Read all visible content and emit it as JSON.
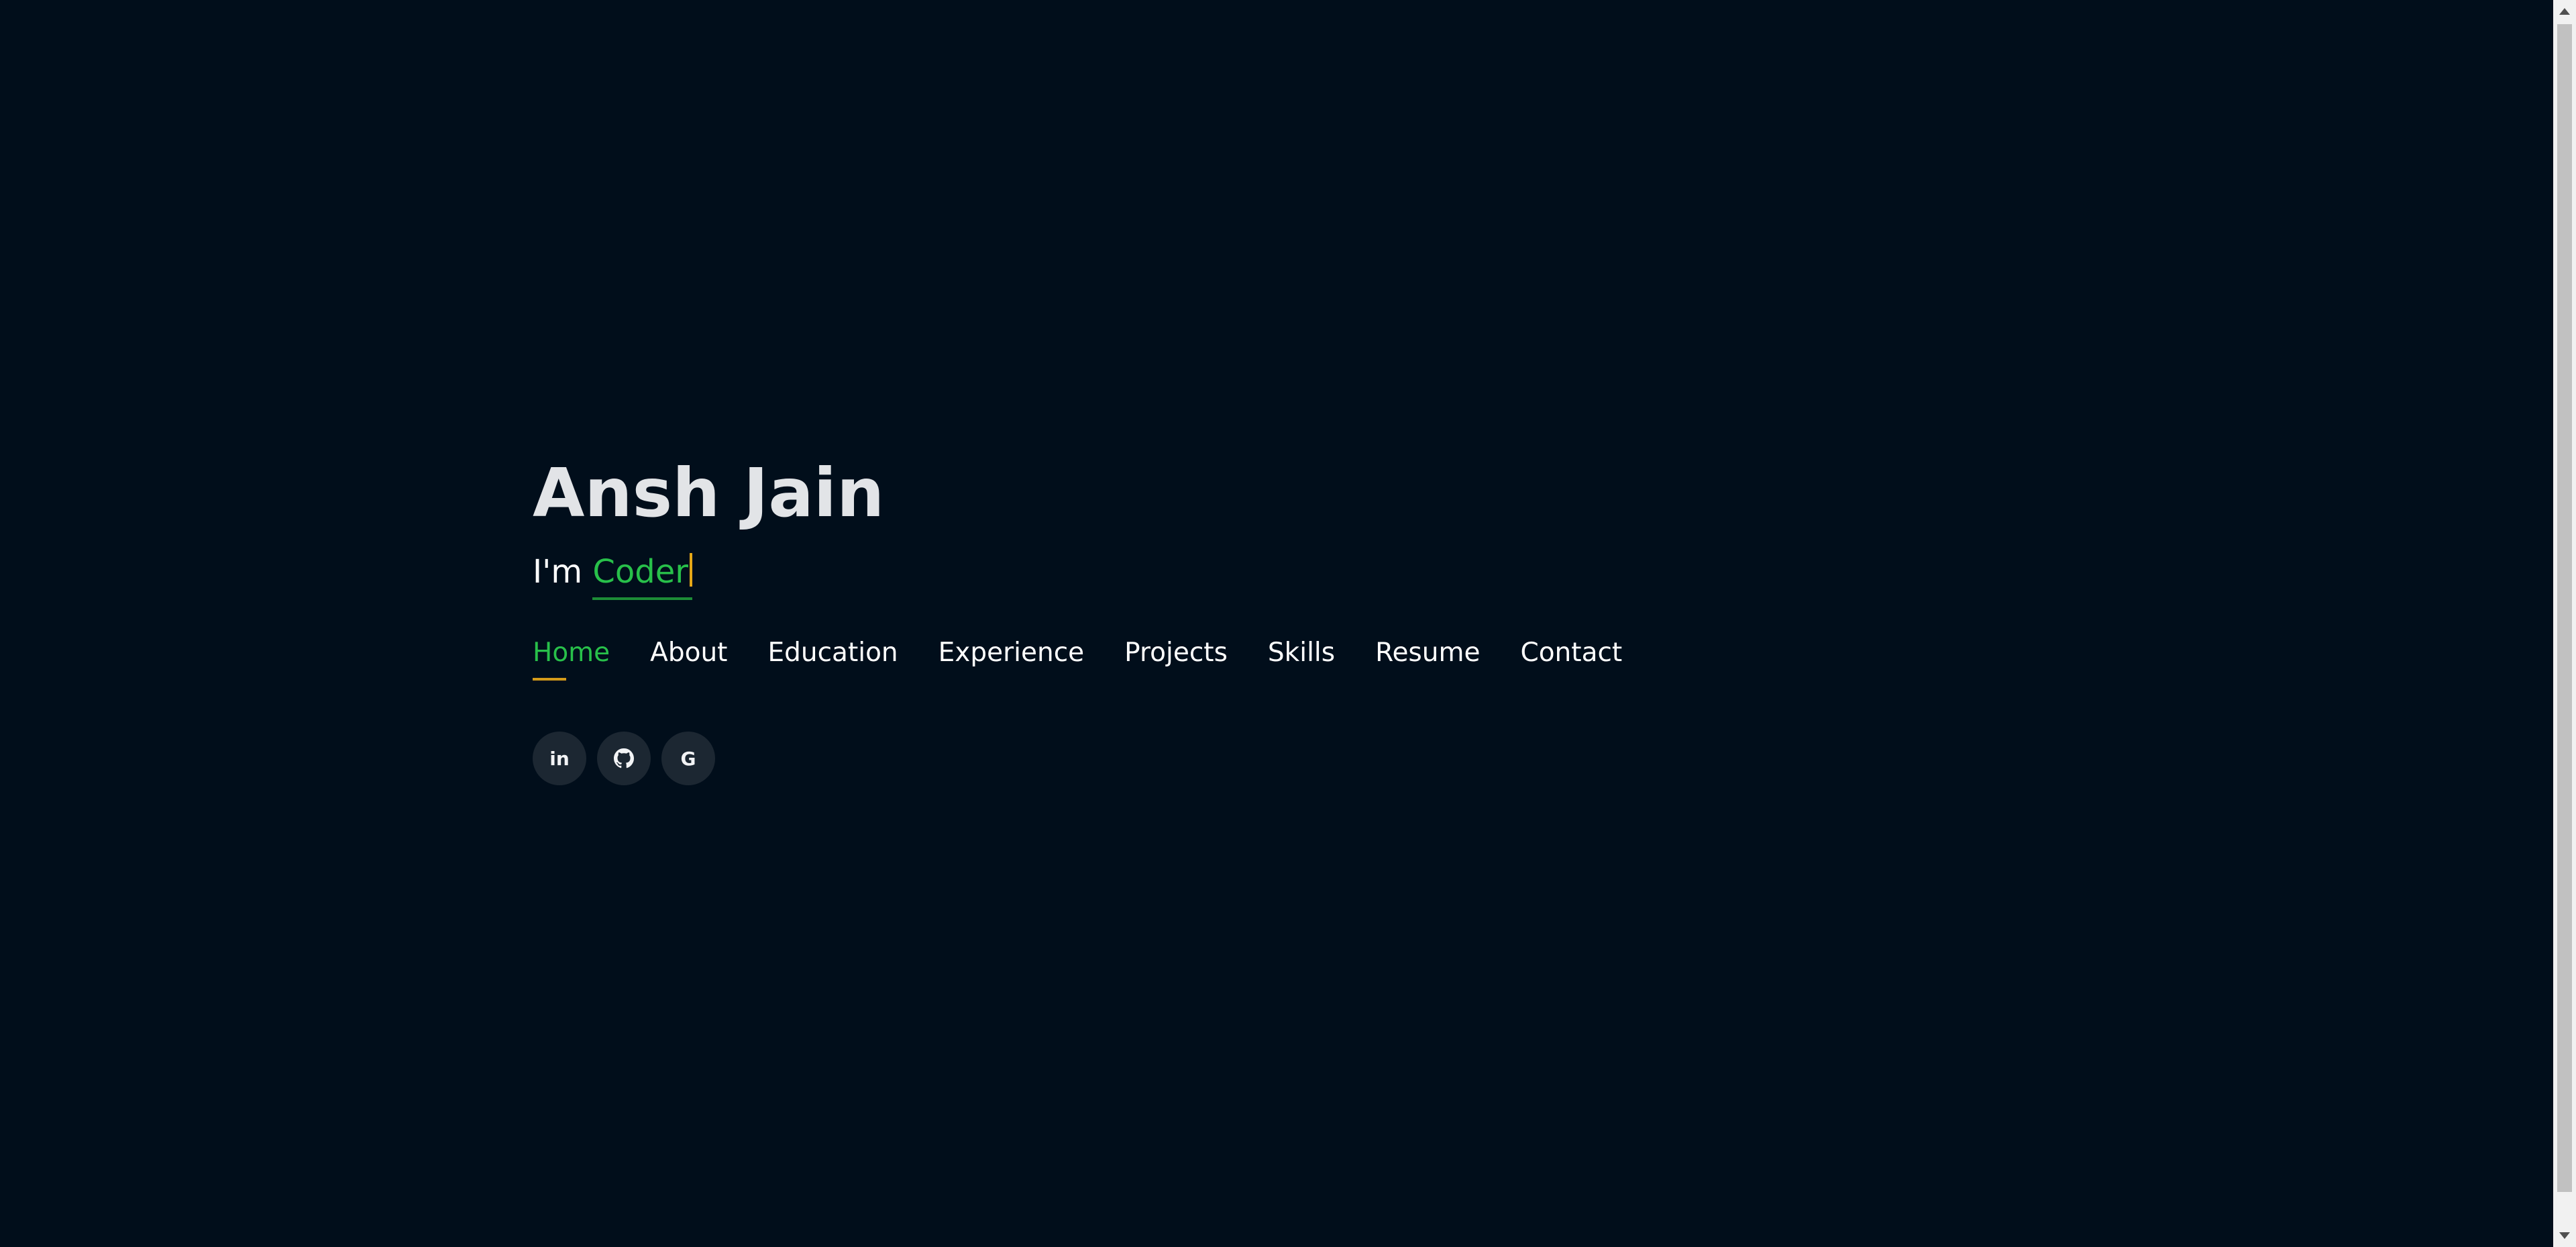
{
  "hero": {
    "name": "Ansh Jain",
    "tagline_prefix": "I'm ",
    "tagline_role": "Coder"
  },
  "nav": {
    "items": [
      {
        "label": "Home",
        "active": true
      },
      {
        "label": "About",
        "active": false
      },
      {
        "label": "Education",
        "active": false
      },
      {
        "label": "Experience",
        "active": false
      },
      {
        "label": "Projects",
        "active": false
      },
      {
        "label": "Skills",
        "active": false
      },
      {
        "label": "Resume",
        "active": false
      },
      {
        "label": "Contact",
        "active": false
      }
    ]
  },
  "social": {
    "linkedin_label": "in",
    "google_label": "G",
    "icons": [
      "linkedin-icon",
      "github-icon",
      "google-icon"
    ]
  },
  "colors": {
    "background": "#010e1b",
    "accent_green": "#28c04a",
    "underline_gold": "#d39b1a",
    "name_text": "#e2e4e7",
    "social_button_bg": "#1c2732"
  }
}
